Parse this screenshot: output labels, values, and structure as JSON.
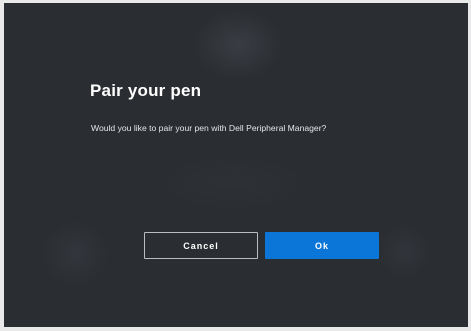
{
  "dialog": {
    "title": "Pair your pen",
    "message": "Would you like to pair your pen with Dell Peripheral Manager?",
    "cancel_label": "Cancel",
    "ok_label": "Ok"
  },
  "colors": {
    "background": "#2a2d31",
    "primary": "#0b76d8",
    "text": "#ffffff"
  }
}
